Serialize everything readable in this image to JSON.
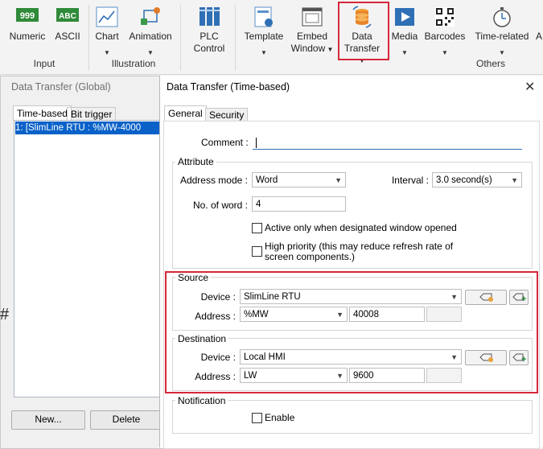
{
  "ribbon": {
    "items": [
      {
        "label": "Numeric",
        "icon": "numeric-icon",
        "glyph": "999"
      },
      {
        "label": "ASCII",
        "icon": "ascii-icon",
        "glyph": "ABC"
      },
      {
        "label": "Chart",
        "icon": "chart-icon"
      },
      {
        "label": "Animation",
        "icon": "animation-icon"
      },
      {
        "label": "PLC",
        "label2": "Control",
        "icon": "plc-control-icon"
      },
      {
        "label": "Template",
        "icon": "template-icon"
      },
      {
        "label": "Embed",
        "label2": "Window",
        "icon": "embed-window-icon"
      },
      {
        "label": "Data",
        "label2": "Transfer",
        "icon": "data-transfer-icon"
      },
      {
        "label": "Media",
        "icon": "media-icon"
      },
      {
        "label": "Barcodes",
        "icon": "barcode-icon"
      },
      {
        "label": "Time-related",
        "icon": "timer-icon"
      }
    ],
    "groups": [
      "Input",
      "Illustration",
      "Others"
    ],
    "overflow": "A"
  },
  "global_window": {
    "title": "Data Transfer (Global)",
    "tabs": [
      "Time-based",
      "Bit trigger"
    ],
    "list": [
      {
        "text": "1:        [SlimLine RTU : %MW-4000"
      }
    ],
    "new_label": "New...",
    "delete_label": "Delete",
    "side_glyph": "#"
  },
  "dialog": {
    "title": "Data Transfer (Time-based)",
    "tabs": [
      "General",
      "Security"
    ],
    "comment_label": "Comment :",
    "comment_value": "",
    "attribute": {
      "legend": "Attribute",
      "address_mode_label": "Address mode :",
      "address_mode_value": "Word",
      "interval_label": "Interval :",
      "interval_value": "3.0 second(s)",
      "no_of_word_label": "No. of word :",
      "no_of_word_value": "4",
      "active_only_label": "Active only when designated window opened",
      "high_priority_label": "High priority (this may reduce refresh rate of screen components.)"
    },
    "source": {
      "legend": "Source",
      "device_label": "Device :",
      "device_value": "SlimLine RTU",
      "address_label": "Address :",
      "address_type": "%MW",
      "address_value": "40008"
    },
    "destination": {
      "legend": "Destination",
      "device_label": "Device :",
      "device_value": "Local HMI",
      "address_label": "Address :",
      "address_type": "LW",
      "address_value": "9600"
    },
    "notification": {
      "legend": "Notification",
      "enable_label": "Enable"
    }
  },
  "colors": {
    "highlight": "#d6283a",
    "selection": "#0a62c9"
  }
}
